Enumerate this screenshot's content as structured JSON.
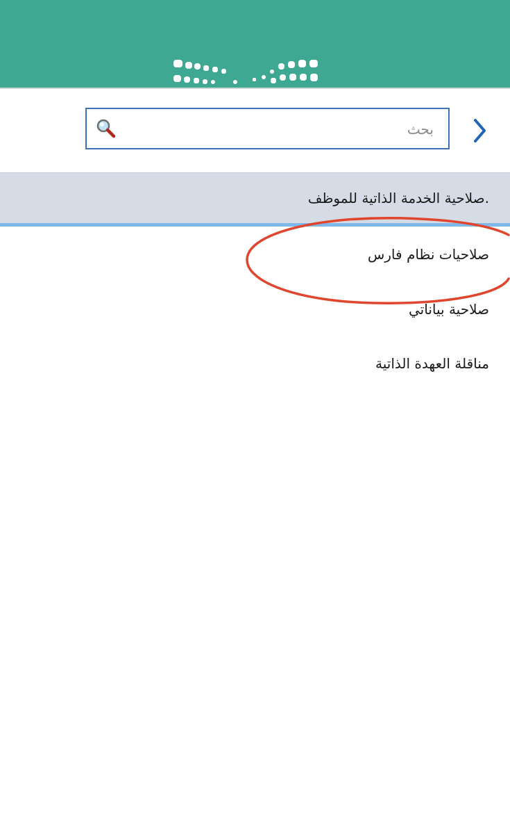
{
  "search": {
    "placeholder": "بحث",
    "value": ""
  },
  "section": {
    "title": ".صلاحية الخدمة الذاتية للموظف"
  },
  "menu": {
    "items": [
      {
        "label": "صلاحيات نظام فارس"
      },
      {
        "label": "صلاحية بياناتي"
      },
      {
        "label": "مناقلة العهدة الذاتية"
      }
    ]
  },
  "icons": {
    "back": "chevron-right-icon",
    "search": "magnifier-icon",
    "logo": "dotted-logo"
  },
  "colors": {
    "header": "#3ea893",
    "accent": "#3b72b8",
    "section_bg": "#d5dce6",
    "section_border": "#7fb8ea",
    "annotation": "#e0452e"
  }
}
